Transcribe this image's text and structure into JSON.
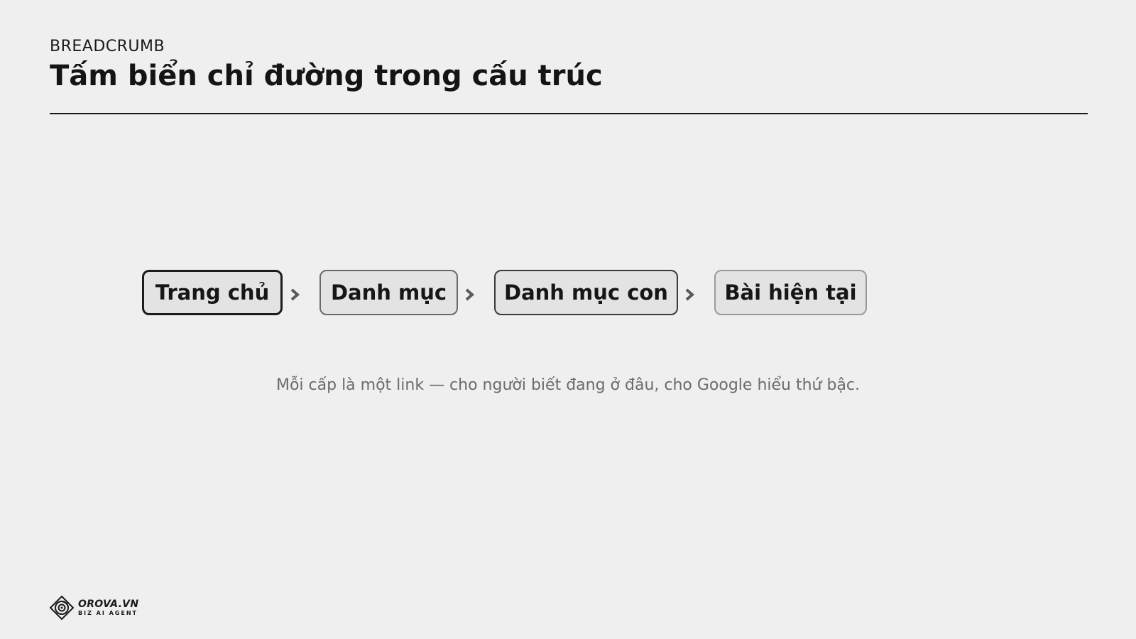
{
  "header": {
    "eyebrow": "BREADCRUMB",
    "title": "Tấm biển chỉ đường trong cấu trúc"
  },
  "breadcrumb": {
    "items": [
      {
        "label": "Trang chủ"
      },
      {
        "label": "Danh mục"
      },
      {
        "label": "Danh mục con"
      },
      {
        "label": "Bài hiện tại"
      }
    ],
    "separator_icon": "chevron-right-icon"
  },
  "caption": "Mỗi cấp là một link — cho người biết đang ở đâu, cho Google hiểu thứ bậc.",
  "footer": {
    "logo_name": "OROVA.VN",
    "logo_tagline": "BIZ AI AGENT",
    "logo_icon": "orova-logo-icon"
  },
  "colors": {
    "background": "#efefef",
    "text": "#161616",
    "muted_text": "#6b6b6b",
    "crumb_fill": "#e3e3e3"
  }
}
